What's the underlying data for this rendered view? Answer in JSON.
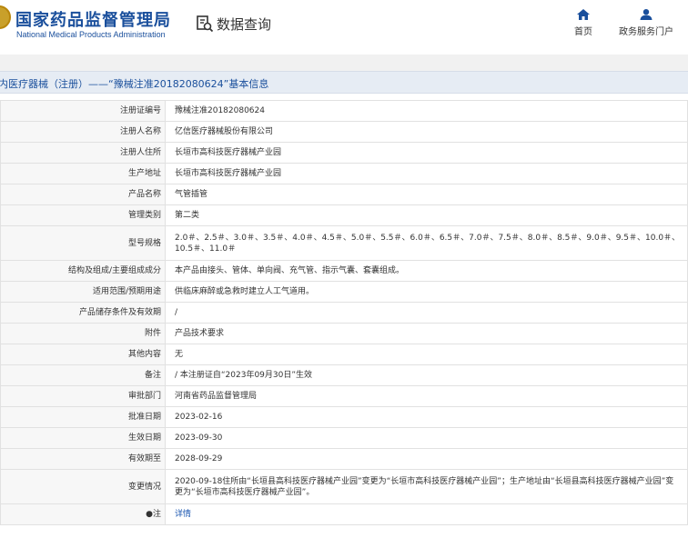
{
  "header": {
    "site_title_cn": "国家药品监督管理局",
    "site_title_en": "National Medical Products Administration",
    "search_label": "数据查询",
    "nav": [
      {
        "label": "首页",
        "icon": "home-icon"
      },
      {
        "label": "政务服务门户",
        "icon": "user-icon"
      }
    ]
  },
  "page_title": "内医疗器械（注册）——“豫械注准20182080624”基本信息",
  "rows": [
    {
      "label": "注册证编号",
      "value": "豫械注准20182080624"
    },
    {
      "label": "注册人名称",
      "value": "亿信医疗器械股份有限公司"
    },
    {
      "label": "注册人住所",
      "value": "长垣市高科技医疗器械产业园"
    },
    {
      "label": "生产地址",
      "value": "长垣市高科技医疗器械产业园"
    },
    {
      "label": "产品名称",
      "value": "气管插管"
    },
    {
      "label": "管理类别",
      "value": "第二类"
    },
    {
      "label": "型号规格",
      "value": "2.0＃、2.5＃、3.0＃、3.5＃、4.0＃、4.5＃、5.0＃、5.5＃、6.0＃、6.5＃、7.0＃、7.5＃、8.0＃、8.5＃、9.0＃、9.5＃、10.0＃、10.5＃、11.0＃"
    },
    {
      "label": "结构及组成/主要组成成分",
      "value": "本产品由接头、管体、单向阀、充气管、指示气囊、套囊组成。"
    },
    {
      "label": "适用范围/预期用途",
      "value": "供临床麻醉或急救时建立人工气道用。"
    },
    {
      "label": "产品储存条件及有效期",
      "value": "/"
    },
    {
      "label": "附件",
      "value": "产品技术要求"
    },
    {
      "label": "其他内容",
      "value": "无"
    },
    {
      "label": "备注",
      "value": "/ 本注册证自“2023年09月30日”生效"
    },
    {
      "label": "审批部门",
      "value": "河南省药品监督管理局"
    },
    {
      "label": "批准日期",
      "value": "2023-02-16"
    },
    {
      "label": "生效日期",
      "value": "2023-09-30"
    },
    {
      "label": "有效期至",
      "value": "2028-09-29"
    },
    {
      "label": "变更情况",
      "value": "2020-09-18住所由“长垣县高科技医疗器械产业园”变更为“长垣市高科技医疗器械产业园”；生产地址由“长垣县高科技医疗器械产业园”变更为“长垣市高科技医疗器械产业园”。"
    },
    {
      "label": "注",
      "value": "详情",
      "link": true
    }
  ]
}
